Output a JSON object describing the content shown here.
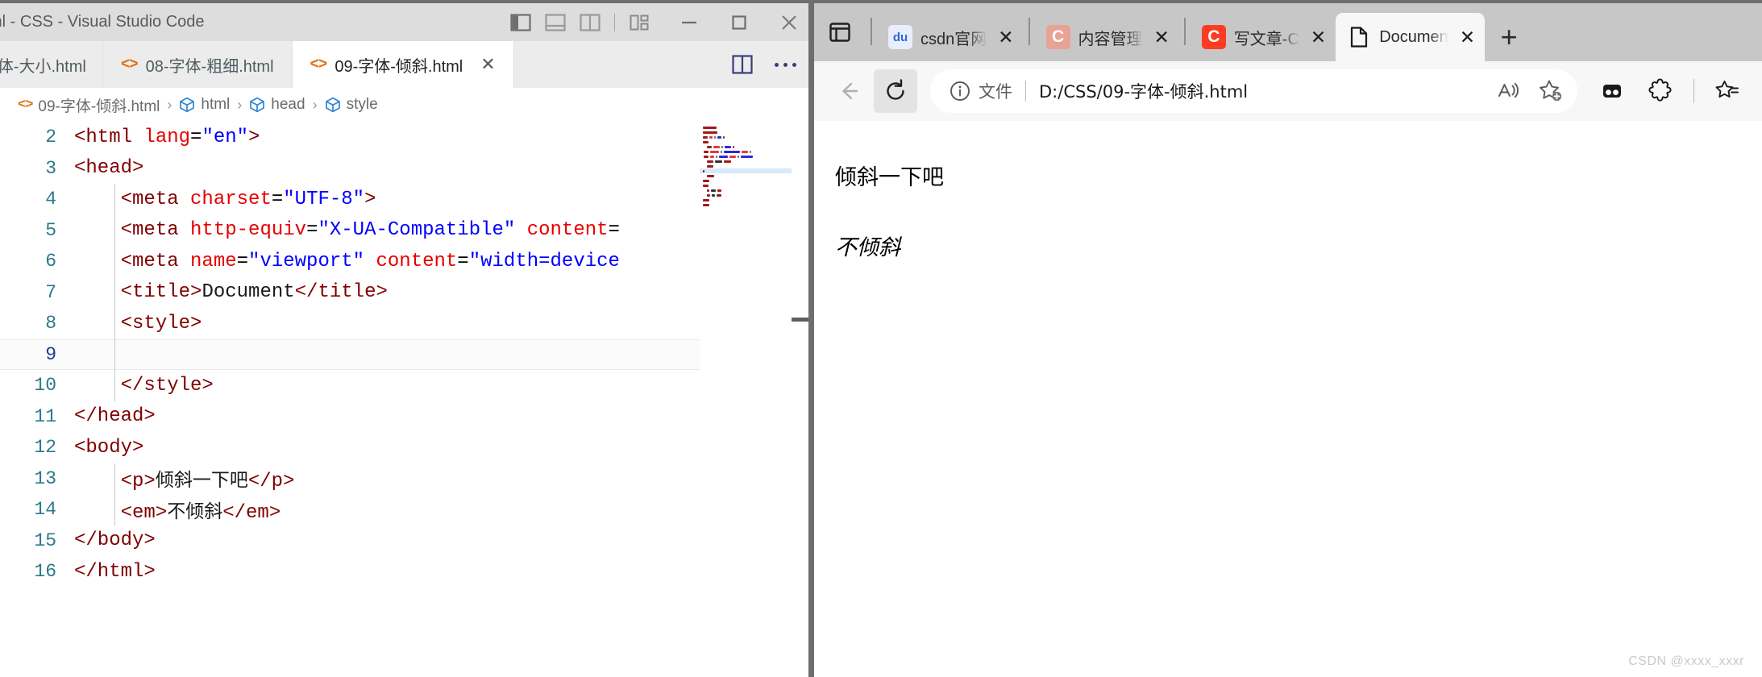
{
  "vscode": {
    "window_title": "ml - CSS - Visual Studio Code",
    "layout_icons": [
      {
        "name": "toggle-primary-sidebar-icon",
        "label": "Toggle Primary Side Bar"
      },
      {
        "name": "toggle-panel-icon",
        "label": "Toggle Panel"
      },
      {
        "name": "toggle-secondary-sidebar-icon",
        "label": "Toggle Secondary Side Bar"
      },
      {
        "name": "customize-layout-icon",
        "label": "Customize Layout"
      }
    ],
    "window_controls": [
      {
        "name": "minimize-button",
        "glyph": "─"
      },
      {
        "name": "maximize-button",
        "glyph": "□"
      },
      {
        "name": "close-button",
        "glyph": "✕"
      }
    ],
    "tabs": [
      {
        "label": "体-大小.html",
        "active": false,
        "clipped": true,
        "close": ""
      },
      {
        "label": "08-字体-粗细.html",
        "active": false,
        "clipped": false,
        "close": ""
      },
      {
        "label": "09-字体-倾斜.html",
        "active": true,
        "clipped": false,
        "close": "✕"
      }
    ],
    "tab_actions": [
      {
        "name": "split-editor-right-icon",
        "label": "Split Editor Right"
      },
      {
        "name": "more-actions-icon",
        "label": "More Actions..."
      }
    ],
    "breadcrumb": [
      {
        "icon": "html-file-icon",
        "label": "09-字体-倾斜.html"
      },
      {
        "icon": "symbol-cube-icon",
        "label": "html"
      },
      {
        "icon": "symbol-cube-icon",
        "label": "head"
      },
      {
        "icon": "symbol-cube-icon",
        "label": "style"
      }
    ],
    "breadcrumb_separator": "›",
    "code_lines": [
      {
        "num": "2",
        "active": false,
        "indent": false,
        "tokens": [
          {
            "t": "tag",
            "v": "<html "
          },
          {
            "t": "attr",
            "v": "lang"
          },
          {
            "t": "eq",
            "v": "="
          },
          {
            "t": "str",
            "v": "\"en\""
          },
          {
            "t": "tag",
            "v": ">"
          }
        ]
      },
      {
        "num": "3",
        "active": false,
        "indent": false,
        "tokens": [
          {
            "t": "tag",
            "v": "<head>"
          }
        ]
      },
      {
        "num": "4",
        "active": false,
        "indent": true,
        "tokens": [
          {
            "t": "tag",
            "v": "    <meta "
          },
          {
            "t": "attr",
            "v": "charset"
          },
          {
            "t": "eq",
            "v": "="
          },
          {
            "t": "str",
            "v": "\"UTF-8\""
          },
          {
            "t": "tag",
            "v": ">"
          }
        ]
      },
      {
        "num": "5",
        "active": false,
        "indent": true,
        "tokens": [
          {
            "t": "tag",
            "v": "    <meta "
          },
          {
            "t": "attr",
            "v": "http-equiv"
          },
          {
            "t": "eq",
            "v": "="
          },
          {
            "t": "str",
            "v": "\"X-UA-Compatible\""
          },
          {
            "t": "attr",
            "v": " content"
          },
          {
            "t": "eq",
            "v": "="
          }
        ]
      },
      {
        "num": "6",
        "active": false,
        "indent": true,
        "tokens": [
          {
            "t": "tag",
            "v": "    <meta "
          },
          {
            "t": "attr",
            "v": "name"
          },
          {
            "t": "eq",
            "v": "="
          },
          {
            "t": "str",
            "v": "\"viewport\""
          },
          {
            "t": "attr",
            "v": " content"
          },
          {
            "t": "eq",
            "v": "="
          },
          {
            "t": "str",
            "v": "\"width=device"
          }
        ]
      },
      {
        "num": "7",
        "active": false,
        "indent": true,
        "tokens": [
          {
            "t": "tag",
            "v": "    <title>"
          },
          {
            "t": "text",
            "v": "Document"
          },
          {
            "t": "tag",
            "v": "</title>"
          }
        ]
      },
      {
        "num": "8",
        "active": false,
        "indent": true,
        "tokens": [
          {
            "t": "tag",
            "v": "    <style>"
          }
        ]
      },
      {
        "num": "9",
        "active": true,
        "indent": true,
        "tokens": [
          {
            "t": "text",
            "v": ""
          }
        ]
      },
      {
        "num": "10",
        "active": false,
        "indent": true,
        "tokens": [
          {
            "t": "tag",
            "v": "    </style>"
          }
        ]
      },
      {
        "num": "11",
        "active": false,
        "indent": false,
        "tokens": [
          {
            "t": "tag",
            "v": "</head>"
          }
        ]
      },
      {
        "num": "12",
        "active": false,
        "indent": false,
        "tokens": [
          {
            "t": "tag",
            "v": "<body>"
          }
        ]
      },
      {
        "num": "13",
        "active": false,
        "indent": true,
        "tokens": [
          {
            "t": "tag",
            "v": "    <p>"
          },
          {
            "t": "cjk",
            "v": "倾斜一下吧"
          },
          {
            "t": "tag",
            "v": "</p>"
          }
        ]
      },
      {
        "num": "14",
        "active": false,
        "indent": true,
        "tokens": [
          {
            "t": "tag",
            "v": "    <em>"
          },
          {
            "t": "cjk",
            "v": "不倾斜"
          },
          {
            "t": "tag",
            "v": "</em>"
          }
        ]
      },
      {
        "num": "15",
        "active": false,
        "indent": false,
        "tokens": [
          {
            "t": "tag",
            "v": "</body>"
          }
        ]
      },
      {
        "num": "16",
        "active": false,
        "indent": false,
        "tokens": [
          {
            "t": "tag",
            "v": "</html>"
          }
        ]
      }
    ]
  },
  "browser": {
    "tab_actions_button": "tab-actions-icon",
    "tabs": [
      {
        "title": "csdn官网",
        "favicon_text": "du",
        "favicon_color": "#ffffff",
        "favicon_bg": "#e8eefc",
        "active": false,
        "close": "✕"
      },
      {
        "title": "内容管理",
        "favicon_text": "C",
        "favicon_color": "#ffffff",
        "favicon_bg": "#e8a296",
        "active": false,
        "close": "✕"
      },
      {
        "title": "写文章-C",
        "favicon_text": "C",
        "favicon_color": "#ffffff",
        "favicon_bg": "#fc3d23",
        "active": false,
        "close": "✕"
      },
      {
        "title": "Documen",
        "favicon_text": "",
        "favicon_color": "#1a1a1a",
        "favicon_bg": "transparent",
        "active": true,
        "close": "✕"
      }
    ],
    "new_tab_glyph": "+",
    "toolbar": {
      "back_icon": "back-arrow-icon",
      "refresh_icon": "refresh-icon",
      "address": {
        "info_icon": "info-circle-icon",
        "scheme_label": "文件",
        "url": "D:/CSS/09-字体-倾斜.html",
        "read_aloud_icon": "read-aloud-icon",
        "add_favorite_icon": "add-favorite-star-icon"
      },
      "right_icons": [
        {
          "name": "split-screen-icon"
        },
        {
          "name": "extensions-puzzle-icon"
        },
        {
          "name": "collections-icon"
        }
      ]
    },
    "page": {
      "paragraph": "倾斜一下吧",
      "emphasis": "不倾斜"
    },
    "watermark": "CSDN @xxxx_xxxr"
  }
}
